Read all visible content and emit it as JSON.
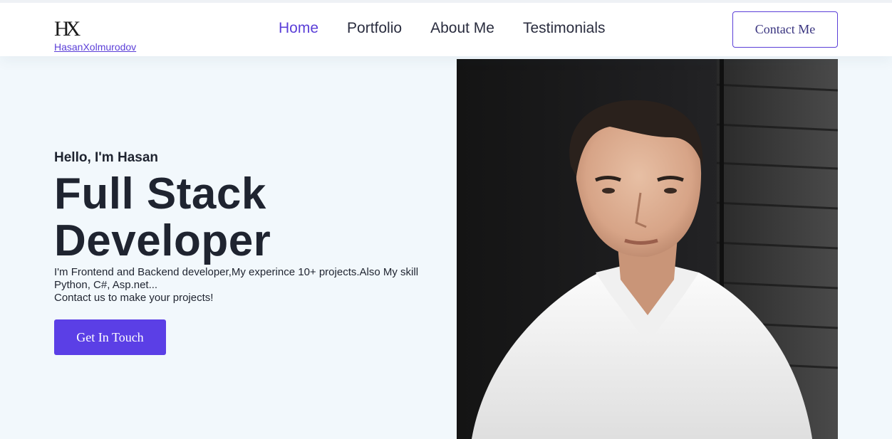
{
  "header": {
    "logo_mark": "HX",
    "logo_name": "HasanXolmurodov",
    "nav": [
      {
        "label": "Home",
        "active": true
      },
      {
        "label": "Portfolio",
        "active": false
      },
      {
        "label": "About Me",
        "active": false
      },
      {
        "label": "Testimonials",
        "active": false
      }
    ],
    "contact_label": "Contact Me"
  },
  "hero": {
    "greeting": "Hello, I'm Hasan",
    "headline_line1": "Full Stack",
    "headline_line2": "Developer",
    "description_line1": "I'm Frontend and Backend developer,My experince 10+ projects.Also My skill",
    "description_line2": "Python, C#, Asp.net...",
    "description_line3": "Contact us to make your projects!",
    "cta_label": "Get In Touch"
  },
  "colors": {
    "accent": "#5b3fe6",
    "hero_background": "#f2f8fc",
    "text": "#1f2430"
  }
}
